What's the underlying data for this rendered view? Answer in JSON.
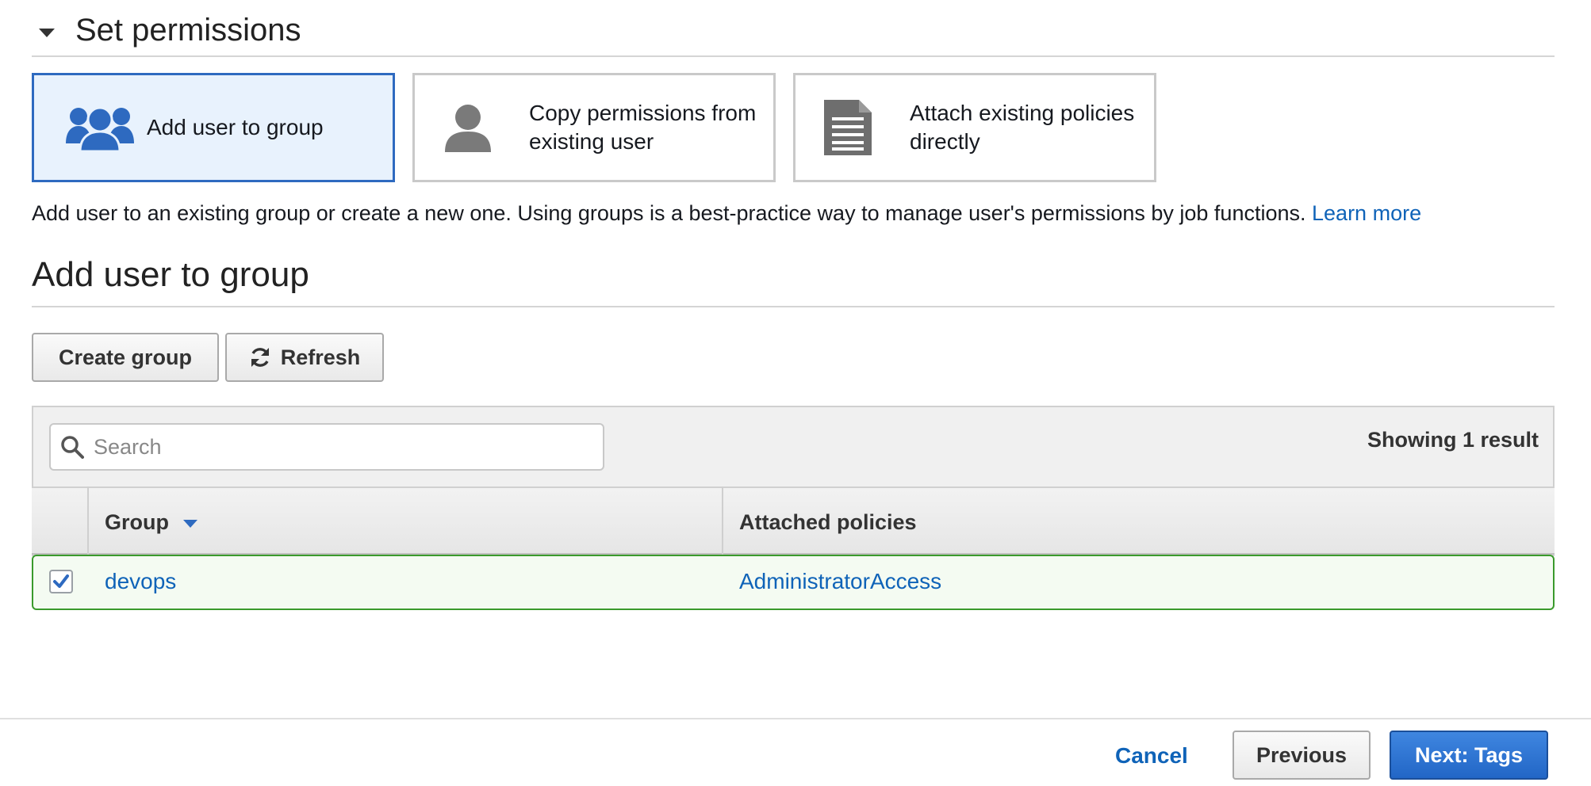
{
  "section": {
    "title": "Set permissions"
  },
  "options": [
    {
      "label": "Add user to group",
      "icon": "users-group-icon",
      "selected": true
    },
    {
      "label": "Copy permissions from existing user",
      "icon": "user-icon",
      "selected": false
    },
    {
      "label": "Attach existing policies directly",
      "icon": "document-icon",
      "selected": false
    }
  ],
  "description": {
    "text": "Add user to an existing group or create a new one. Using groups is a best-practice way to manage user's permissions by job functions.",
    "link": "Learn more"
  },
  "group_section": {
    "title": "Add user to group"
  },
  "toolbar": {
    "create_label": "Create group",
    "refresh_label": "Refresh"
  },
  "search": {
    "placeholder": "Search",
    "value": ""
  },
  "results": {
    "count_text": "Showing 1 result"
  },
  "table": {
    "columns": [
      "Group",
      "Attached policies"
    ],
    "sort_column": "Group",
    "rows": [
      {
        "checked": true,
        "group": "devops",
        "policies": "AdministratorAccess"
      }
    ]
  },
  "footer": {
    "cancel_label": "Cancel",
    "previous_label": "Previous",
    "next_label": "Next: Tags"
  },
  "colors": {
    "accent": "#2e6ac0",
    "link": "#0f63b8",
    "selected_row_border": "#3a9a2c",
    "primary_button": "#2266c6"
  }
}
